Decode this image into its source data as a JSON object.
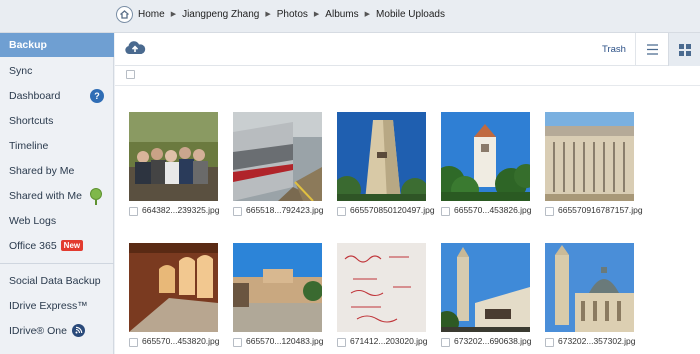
{
  "breadcrumb": [
    "Home",
    "Jiangpeng Zhang",
    "Photos",
    "Albums",
    "Mobile Uploads"
  ],
  "sidebar": {
    "items": [
      {
        "label": "Backup",
        "active": true
      },
      {
        "label": "Sync"
      },
      {
        "label": "Dashboard",
        "icon": "help-icon"
      },
      {
        "label": "Shortcuts"
      },
      {
        "label": "Timeline"
      },
      {
        "label": "Shared by Me"
      },
      {
        "label": "Shared with Me",
        "icon": "pin-icon"
      },
      {
        "label": "Web Logs"
      },
      {
        "label": "Office 365",
        "badge": "New"
      },
      {
        "label": "Social Data Backup"
      },
      {
        "label": "IDrive Express™"
      },
      {
        "label": "IDrive® One",
        "icon": "rss-icon"
      }
    ]
  },
  "toolbar": {
    "upload_icon": "cloud-upload-icon",
    "trash_label": "Trash",
    "list_view_icon": "list-view-icon",
    "grid_view_icon": "grid-view-icon"
  },
  "photos": [
    {
      "name": "664382...239325.jpg",
      "scene": "group-photo"
    },
    {
      "name": "665518...792423.jpg",
      "scene": "train-platform"
    },
    {
      "name": "665570850120497.jpg",
      "scene": "tower-low"
    },
    {
      "name": "665570...453826.jpg",
      "scene": "tower-trees"
    },
    {
      "name": "665570916787157.jpg",
      "scene": "building-facade"
    },
    {
      "name": "665570...453820.jpg",
      "scene": "arcade"
    },
    {
      "name": "665570...120483.jpg",
      "scene": "plaza"
    },
    {
      "name": "671412...203020.jpg",
      "scene": "whiteboard"
    },
    {
      "name": "673202...690638.jpg",
      "scene": "tower-sign"
    },
    {
      "name": "673202...357302.jpg",
      "scene": "dome-church"
    }
  ],
  "colors": {
    "active_sidebar": "#6f9fd2",
    "new_badge": "#e23b2f",
    "link": "#2a4f86"
  }
}
